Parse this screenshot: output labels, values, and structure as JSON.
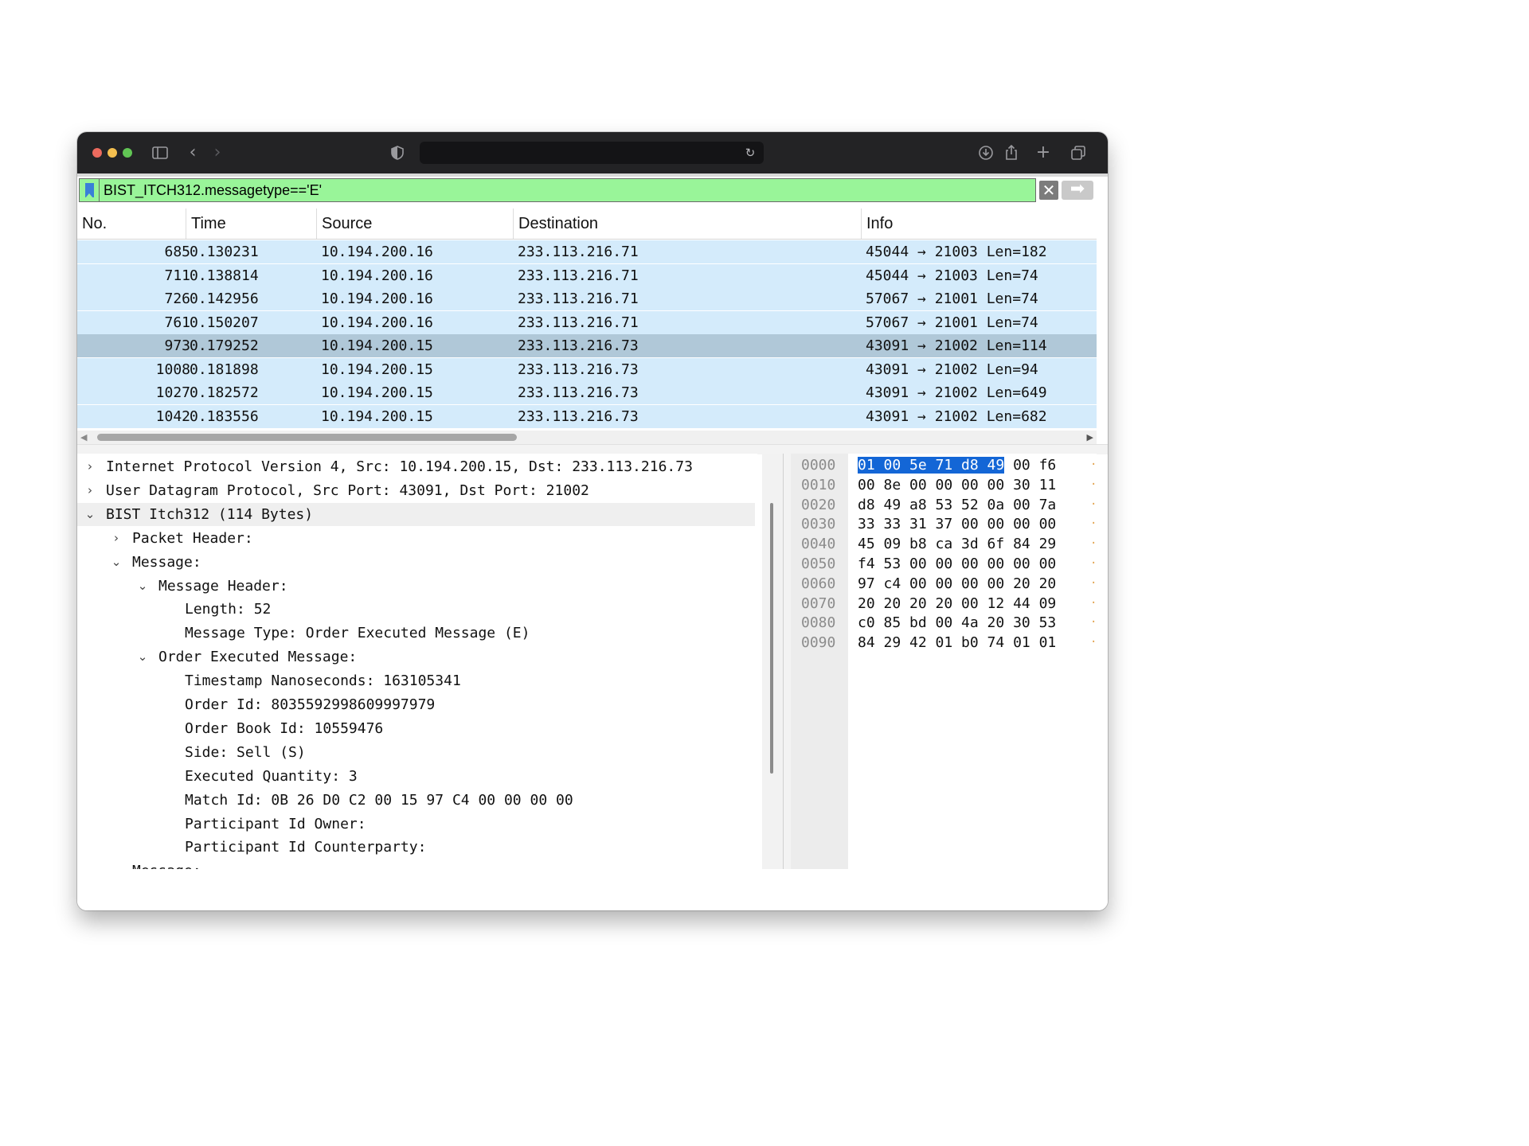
{
  "browser": {
    "address": "",
    "icons": [
      "sidebar-icon",
      "back-icon",
      "forward-icon",
      "shield-icon",
      "reload-icon",
      "download-icon",
      "share-icon",
      "new-tab-icon",
      "tabs-icon"
    ]
  },
  "filter": {
    "value": "BIST_ITCH312.messagetype=='E'",
    "clear_glyph": "✕",
    "apply_glyph": "➡"
  },
  "packet_list": {
    "columns": [
      "No.",
      "Time",
      "Source",
      "Destination",
      "Info"
    ],
    "rows": [
      {
        "no": "685",
        "time": "0.130231",
        "src": "10.194.200.16",
        "dst": "233.113.216.71",
        "info": "45044 → 21003 Len=182"
      },
      {
        "no": "711",
        "time": "0.138814",
        "src": "10.194.200.16",
        "dst": "233.113.216.71",
        "info": "45044 → 21003 Len=74"
      },
      {
        "no": "726",
        "time": "0.142956",
        "src": "10.194.200.16",
        "dst": "233.113.216.71",
        "info": "57067 → 21001 Len=74"
      },
      {
        "no": "761",
        "time": "0.150207",
        "src": "10.194.200.16",
        "dst": "233.113.216.71",
        "info": "57067 → 21001 Len=74"
      },
      {
        "no": "973",
        "time": "0.179252",
        "src": "10.194.200.15",
        "dst": "233.113.216.73",
        "info": "43091 → 21002 Len=114"
      },
      {
        "no": "1008",
        "time": "0.181898",
        "src": "10.194.200.15",
        "dst": "233.113.216.73",
        "info": "43091 → 21002 Len=94"
      },
      {
        "no": "1027",
        "time": "0.182572",
        "src": "10.194.200.15",
        "dst": "233.113.216.73",
        "info": "43091 → 21002 Len=649"
      },
      {
        "no": "1042",
        "time": "0.183556",
        "src": "10.194.200.15",
        "dst": "233.113.216.73",
        "info": "43091 → 21002 Len=682"
      }
    ],
    "selected_no": "973"
  },
  "details": {
    "rows": [
      {
        "toggle": "›",
        "text": "Internet Protocol Version 4, Src: 10.194.200.15, Dst: 233.113.216.73"
      },
      {
        "toggle": "›",
        "text": "User Datagram Protocol, Src Port: 43091, Dst Port: 21002"
      },
      {
        "toggle": "⌄",
        "text": "BIST Itch312 (114 Bytes)"
      },
      {
        "toggle": "›",
        "text": "Packet Header:"
      },
      {
        "toggle": "⌄",
        "text": "Message:"
      },
      {
        "toggle": "⌄",
        "text": "Message Header:"
      },
      {
        "toggle": "",
        "text": "Length: 52"
      },
      {
        "toggle": "",
        "text": "Message Type: Order Executed Message (E)"
      },
      {
        "toggle": "⌄",
        "text": "Order Executed Message:"
      },
      {
        "toggle": "",
        "text": "Timestamp Nanoseconds: 163105341"
      },
      {
        "toggle": "",
        "text": "Order Id: 8035592998609997979"
      },
      {
        "toggle": "",
        "text": "Order Book Id: 10559476"
      },
      {
        "toggle": "",
        "text": "Side: Sell (S)"
      },
      {
        "toggle": "",
        "text": "Executed Quantity: 3"
      },
      {
        "toggle": "",
        "text": "Match Id: 0B 26 D0 C2 00 15 97 C4 00 00 00 00"
      },
      {
        "toggle": "",
        "text": "Participant Id Owner:"
      },
      {
        "toggle": "",
        "text": "Participant Id Counterparty:"
      },
      {
        "toggle": "⌄",
        "text": "Message:"
      }
    ]
  },
  "hex": {
    "rows": [
      {
        "offset": "0000",
        "sel": "01 00 5e 71 d8 49",
        "rest": " 00 f6"
      },
      {
        "offset": "0010",
        "sel": "",
        "rest": "00 8e 00 00 00 00 30 11"
      },
      {
        "offset": "0020",
        "sel": "",
        "rest": "d8 49 a8 53 52 0a 00 7a"
      },
      {
        "offset": "0030",
        "sel": "",
        "rest": "33 33 31 37 00 00 00 00"
      },
      {
        "offset": "0040",
        "sel": "",
        "rest": "45 09 b8 ca 3d 6f 84 29"
      },
      {
        "offset": "0050",
        "sel": "",
        "rest": "f4 53 00 00 00 00 00 00"
      },
      {
        "offset": "0060",
        "sel": "",
        "rest": "97 c4 00 00 00 00 20 20"
      },
      {
        "offset": "0070",
        "sel": "",
        "rest": "20 20 20 20 00 12 44 09"
      },
      {
        "offset": "0080",
        "sel": "",
        "rest": "c0 85 bd 00 4a 20 30 53"
      },
      {
        "offset": "0090",
        "sel": "",
        "rest": "84 29 42 01 b0 74 01 01"
      }
    ]
  },
  "colors": {
    "filter_bg": "#99f599",
    "row_bg": "#d4ebfb",
    "row_selected_bg": "#b0c8d8",
    "hex_selection": "#1366d6"
  }
}
